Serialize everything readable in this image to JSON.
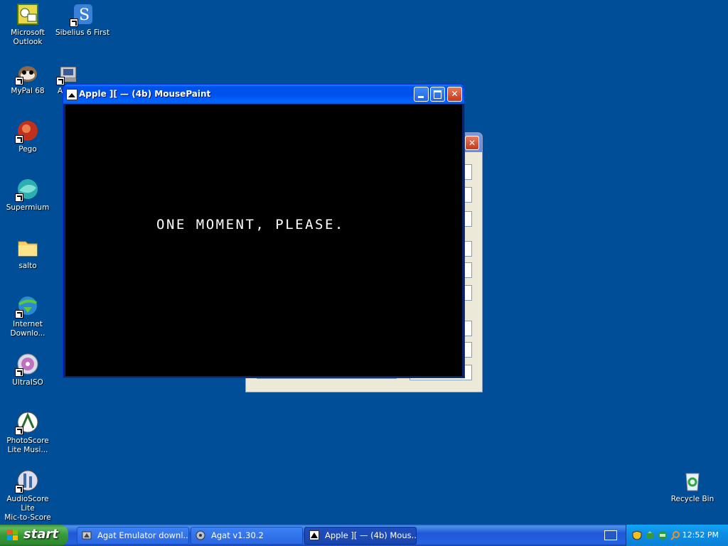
{
  "desktop": {
    "icons": [
      {
        "label": "Microsoft\nOutlook",
        "icon": "outlook-icon"
      },
      {
        "label": "Sibelius 6 First",
        "icon": "sibelius-icon"
      },
      {
        "label": "MyPal 68",
        "icon": "mypal-icon"
      },
      {
        "label": "A",
        "icon": "agat-icon"
      },
      {
        "label": "Pego",
        "icon": "pego-icon"
      },
      {
        "label": "Supermium",
        "icon": "supermium-icon"
      },
      {
        "label": "salto",
        "icon": "folder-icon"
      },
      {
        "label": "Internet\nDownlo...",
        "icon": "internet-download-manager-icon"
      },
      {
        "label": "UltraISO",
        "icon": "ultraiso-icon"
      },
      {
        "label": "PhotoScore\nLite Musi...",
        "icon": "photoscore-icon"
      },
      {
        "label": "AudioScore Lite\nMic-to-Score",
        "icon": "audioscore-icon"
      },
      {
        "label": "Recycle Bin",
        "icon": "recycle-bin-icon"
      }
    ]
  },
  "apple_window": {
    "title": "Apple ][ — (4b) MousePaint",
    "screen_text": "ONE MOMENT, PLEASE."
  },
  "taskbar": {
    "start_label": "start",
    "items": [
      {
        "label": "Agat Emulator downl...",
        "active": false
      },
      {
        "label": "Agat v1.30.2",
        "active": false
      },
      {
        "label": "Apple ][ — (4b) Mous...",
        "active": true
      }
    ],
    "clock": "12:52 PM"
  },
  "colors": {
    "desktop_bg": "#004e98",
    "titlebar": "#0053ee",
    "start_green": "#379837"
  }
}
